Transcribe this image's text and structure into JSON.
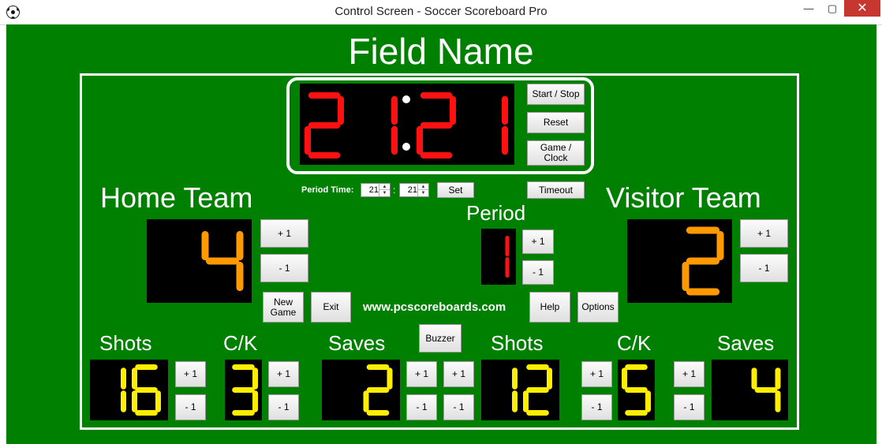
{
  "window": {
    "title": "Control Screen - Soccer Scoreboard Pro",
    "minimize": "—",
    "maximize": "▢",
    "close": "✕"
  },
  "field_name": "Field Name",
  "clock": {
    "minutes": "21",
    "seconds": "21",
    "color": "#ff1111"
  },
  "clock_buttons": {
    "start_stop": "Start / Stop",
    "reset": "Reset",
    "game_clock_1": "Game /",
    "game_clock_2": "Clock",
    "timeout": "Timeout"
  },
  "period_time": {
    "label": "Period Time:",
    "minutes": "21",
    "separator": ":",
    "seconds": "21",
    "set": "Set"
  },
  "period": {
    "label": "Period",
    "value": "1",
    "plus": "+ 1",
    "minus": "- 1"
  },
  "home": {
    "name": "Home Team",
    "score": "4",
    "plus": "+ 1",
    "minus": "- 1"
  },
  "visitor": {
    "name": "Visitor Team",
    "score": "2",
    "plus": "+ 1",
    "minus": "- 1"
  },
  "score_color": "#ff9900",
  "stat_color": "#ffee00",
  "controls": {
    "new_game_1": "New",
    "new_game_2": "Game",
    "exit": "Exit",
    "help": "Help",
    "options": "Options",
    "buzzer": "Buzzer"
  },
  "website": "www.pcscoreboards.com",
  "stats": {
    "home_shots": {
      "label": "Shots",
      "value": "16"
    },
    "home_ck": {
      "label": "C/K",
      "value": "3"
    },
    "home_saves": {
      "label": "Saves",
      "value": "2"
    },
    "visitor_shots": {
      "label": "Shots",
      "value": "12"
    },
    "visitor_ck": {
      "label": "C/K",
      "value": "5"
    },
    "visitor_saves": {
      "label": "Saves",
      "value": "4"
    },
    "plus": "+ 1",
    "minus": "- 1"
  }
}
